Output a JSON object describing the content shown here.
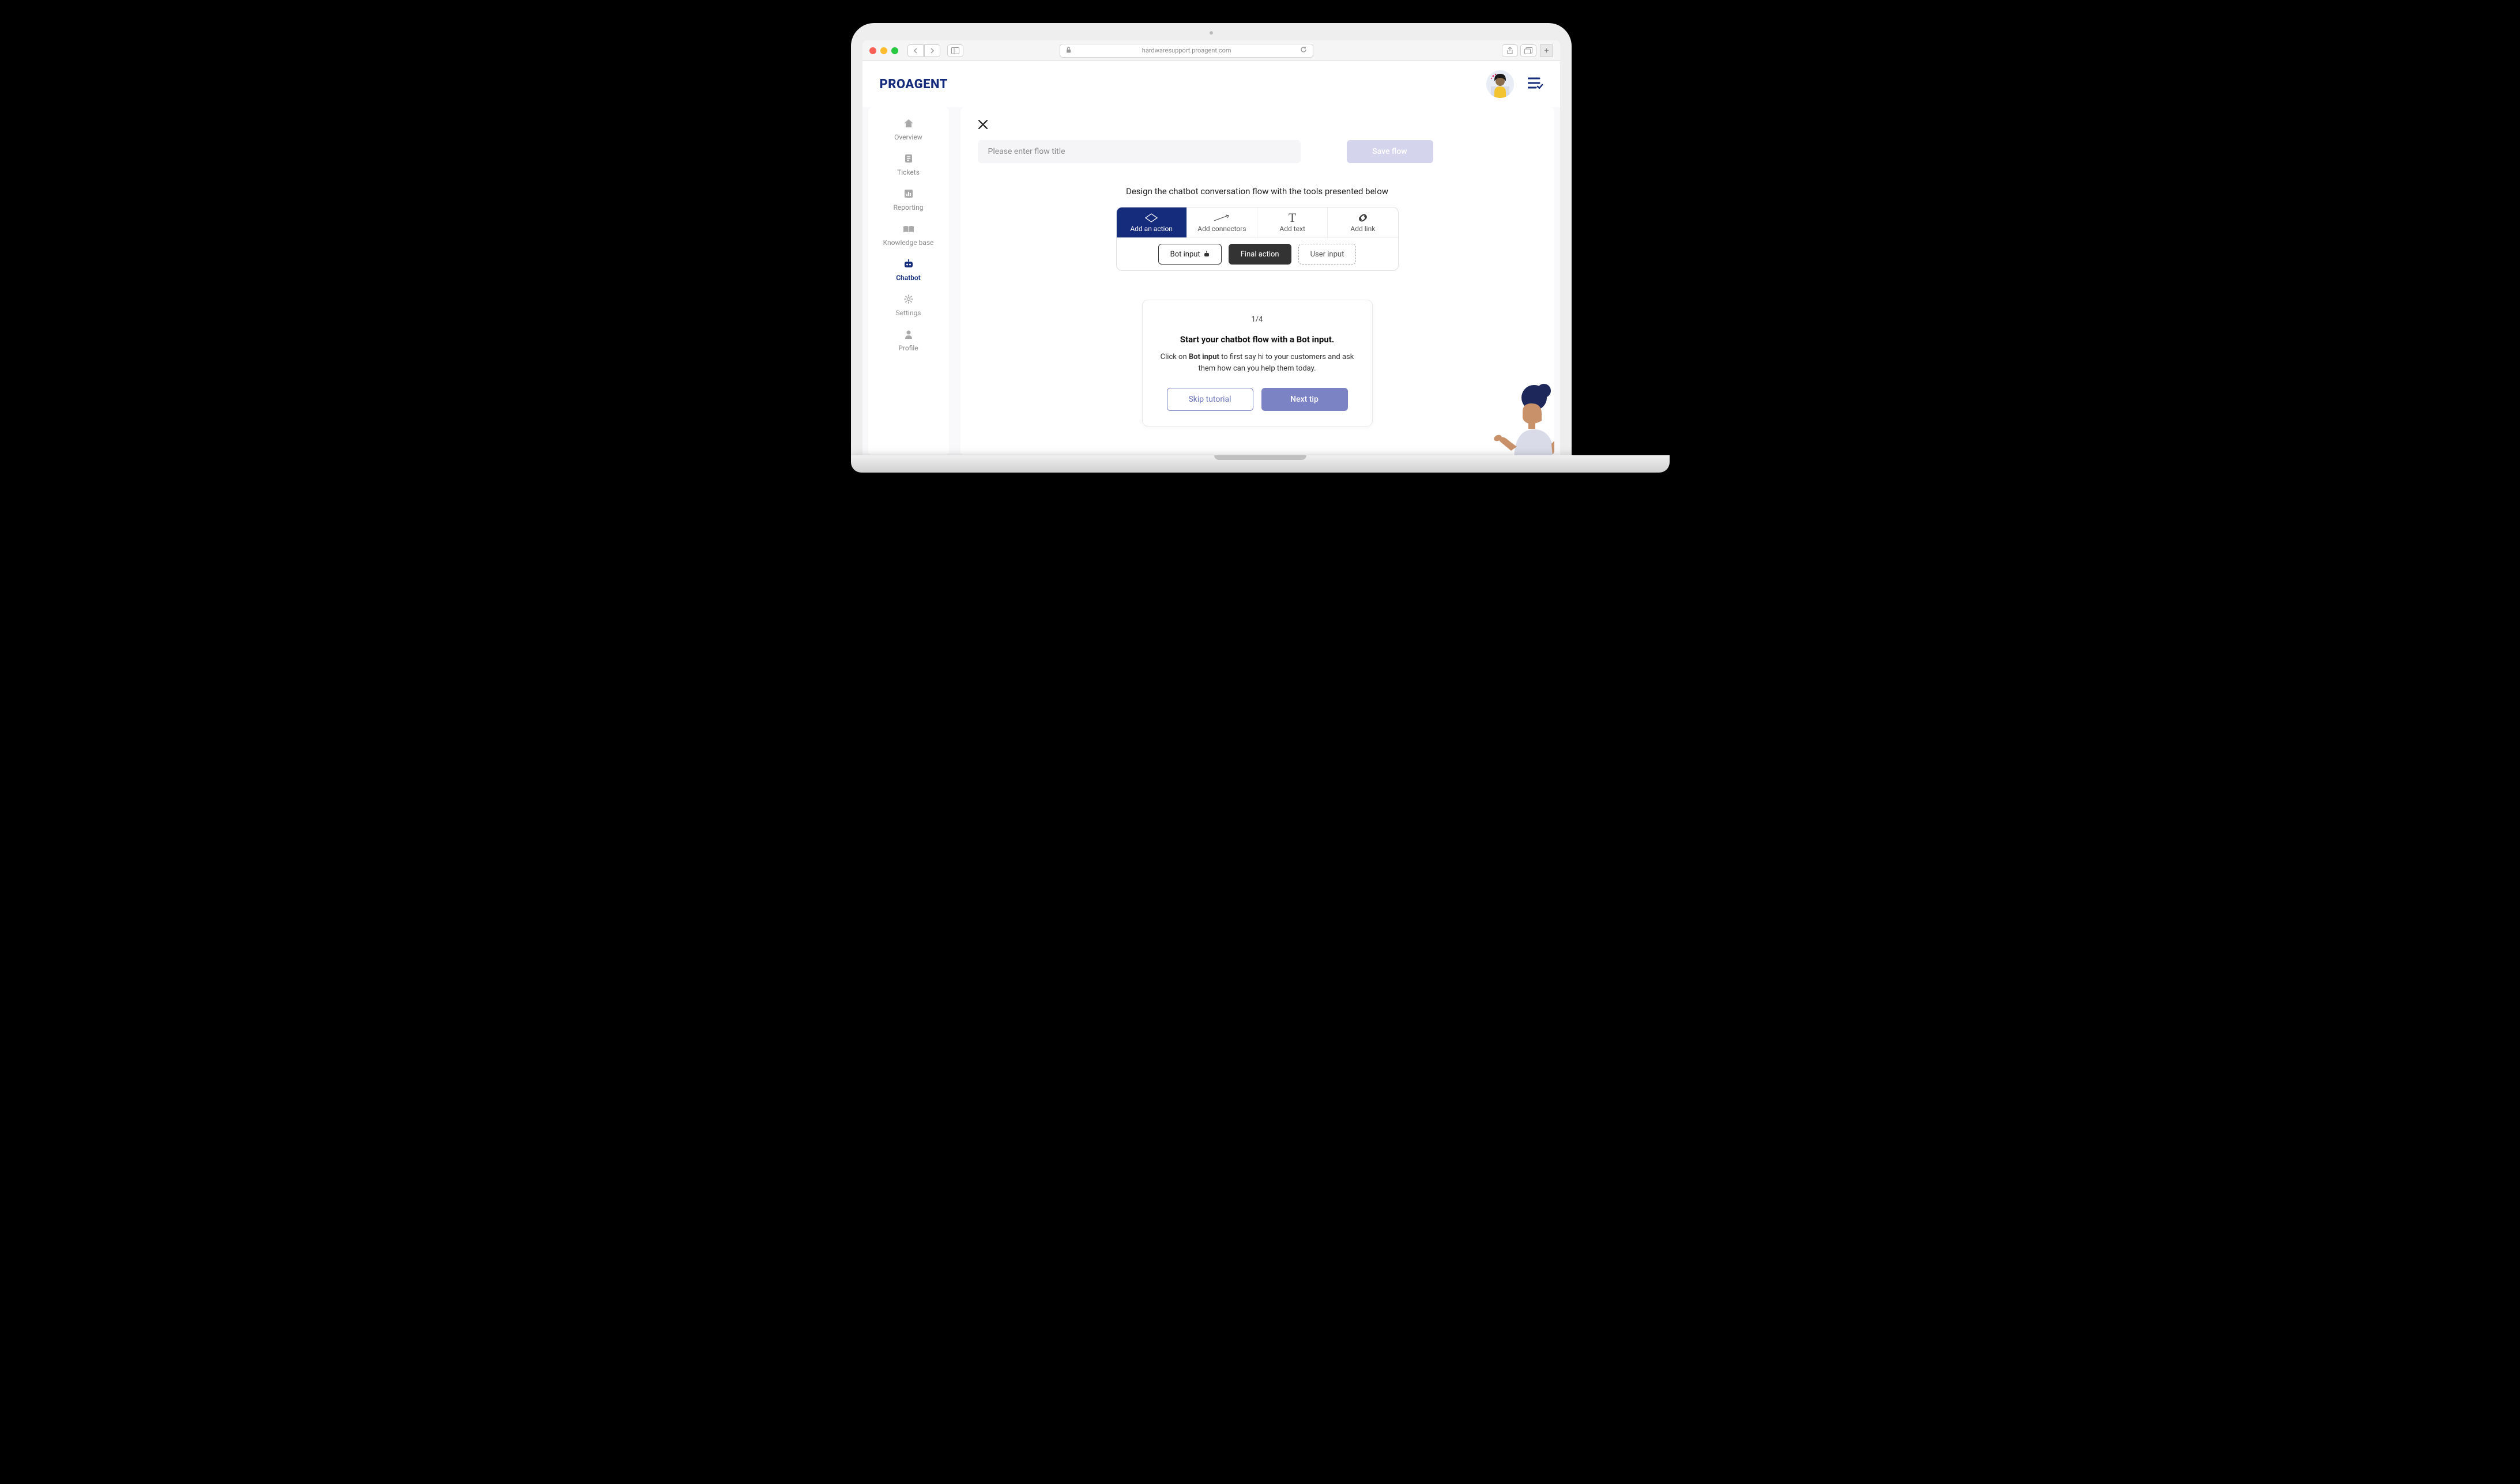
{
  "browser": {
    "url": "hardwaresupport.proagent.com"
  },
  "header": {
    "logo": "PROAGENT"
  },
  "sidebar": {
    "items": [
      {
        "label": "Overview",
        "icon": "home"
      },
      {
        "label": "Tickets",
        "icon": "document"
      },
      {
        "label": "Reporting",
        "icon": "chart"
      },
      {
        "label": "Knowledge base",
        "icon": "book"
      },
      {
        "label": "Chatbot",
        "icon": "bot",
        "active": true
      },
      {
        "label": "Settings",
        "icon": "gear"
      },
      {
        "label": "Profile",
        "icon": "user"
      }
    ]
  },
  "main": {
    "title_placeholder": "Please enter flow title",
    "save_label": "Save flow",
    "instruction": "Design the chatbot conversation flow with the tools presented below",
    "toolbar": {
      "tabs": [
        {
          "label": "Add an action",
          "active": true
        },
        {
          "label": "Add connectors"
        },
        {
          "label": "Add text"
        },
        {
          "label": "Add link"
        }
      ],
      "actions": {
        "bot_input": "Bot input",
        "final_action": "Final action",
        "user_input": "User input"
      }
    },
    "tutorial": {
      "step": "1/4",
      "title": "Start your chatbot flow with a Bot input.",
      "body_prefix": "Click on ",
      "body_bold": "Bot input",
      "body_suffix": " to first say hi to your customers and ask them how can you help them today.",
      "skip_label": "Skip tutorial",
      "next_label": "Next tip"
    }
  }
}
